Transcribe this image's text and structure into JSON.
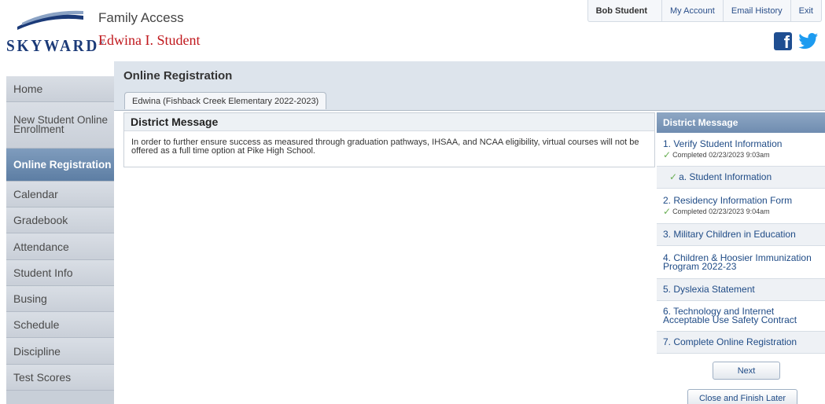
{
  "header": {
    "logo_text": "SKYWARD",
    "logo_mark": "®",
    "app_title": "Family Access",
    "student_name": "Edwina I. Student"
  },
  "top_links": {
    "user_name": "Bob Student",
    "my_account": "My Account",
    "email_history": "Email History",
    "exit": "Exit"
  },
  "social": {
    "facebook_icon": "facebook-icon",
    "twitter_icon": "twitter-icon",
    "facebook_color": "#1f4e91",
    "twitter_color": "#1d9bf0"
  },
  "sidebar": {
    "items": [
      {
        "label": "Home"
      },
      {
        "label": "New Student Online Enrollment"
      },
      {
        "label": "Online Registration",
        "active": true
      },
      {
        "label": "Calendar"
      },
      {
        "label": "Gradebook"
      },
      {
        "label": "Attendance"
      },
      {
        "label": "Student Info"
      },
      {
        "label": "Busing"
      },
      {
        "label": "Schedule"
      },
      {
        "label": "Discipline"
      },
      {
        "label": "Test Scores"
      }
    ]
  },
  "main": {
    "page_title": "Online Registration",
    "tab_label": "Edwina (Fishback Creek Elementary 2022-2023)",
    "message": {
      "title": "District Message",
      "body": "In order to further ensure success as measured through graduation pathways, IHSAA, and NCAA eligibility, virtual courses will not be offered as a full time option at Pike High School."
    },
    "steps": {
      "header": "District Message",
      "items": [
        {
          "label": "1. Verify Student Information",
          "status": "Completed 02/23/2023 9:03am"
        },
        {
          "label": "a. Student Information"
        },
        {
          "label": "2. Residency Information Form",
          "status": "Completed 02/23/2023 9:04am"
        },
        {
          "label": "3. Military Children in Education"
        },
        {
          "label": "4. Children & Hoosier Immunization Program 2022-23"
        },
        {
          "label": "5. Dyslexia Statement"
        },
        {
          "label": "6. Technology and Internet Acceptable Use Safety Contract"
        },
        {
          "label": "7. Complete Online Registration"
        }
      ]
    },
    "buttons": {
      "next": "Next",
      "close_finish": "Close and Finish Later"
    }
  },
  "colors": {
    "brand_blue": "#1b3a78",
    "student_red": "#c0181d",
    "active_nav": "#6a89ae",
    "link_blue": "#1f4b86",
    "check_green": "#6aaf55"
  }
}
